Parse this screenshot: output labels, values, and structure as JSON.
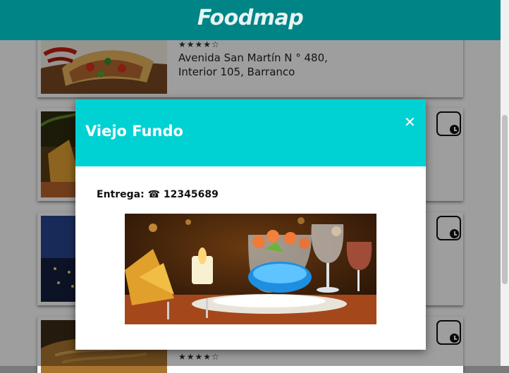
{
  "header": {
    "brand": "Foodmap"
  },
  "cards": [
    {
      "rating": "★★★★☆",
      "address_line1": "Avenida San Martín N ° 480,",
      "address_line2": "Interior 105, Barranco",
      "image": "tacos-photo"
    },
    {
      "image": "table-setting-photo",
      "favorite_icon": "clock-icon"
    },
    {
      "image": "night-terrace-photo",
      "favorite_icon": "clock-icon"
    },
    {
      "rating": "★★★★☆",
      "image": "noodles-photo",
      "favorite_icon": "clock-icon"
    }
  ],
  "modal": {
    "title": "Viejo Fundo",
    "close_symbol": "✕",
    "delivery_label": "Entrega:",
    "phone_icon": "☎",
    "phone": "12345689",
    "image": "seafood-cocktail-photo"
  },
  "colors": {
    "header": "#008486",
    "modal_header": "#00d1d3"
  }
}
